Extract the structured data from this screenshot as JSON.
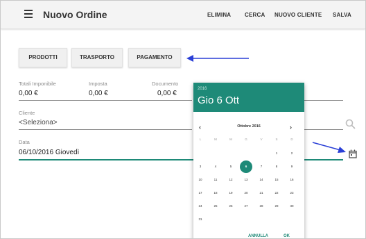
{
  "appbar": {
    "title": "Nuovo Ordine",
    "actions": [
      "ELIMINA",
      "CERCA",
      "NUOVO CLIENTE",
      "SALVA"
    ]
  },
  "tabs": [
    "PRODOTTI",
    "TRASPORTO",
    "PAGAMENTO"
  ],
  "totals": {
    "imponibile_label": "Totali Imponibile",
    "imponibile_value": "0,00 €",
    "imposta_label": "Imposta",
    "imposta_value": "0,00 €",
    "documento_label": "Documento",
    "documento_value": "0,00 €"
  },
  "cliente": {
    "label": "Cliente",
    "value": "<Seleziona>"
  },
  "data": {
    "label": "Data",
    "value": "06/10/2016  Giovedì"
  },
  "datepicker": {
    "year": "2016",
    "selected_date": "Gio 6 Ott",
    "month_label": "Ottobre 2016",
    "prev": "‹",
    "next": "›",
    "weekdays": [
      "L",
      "M",
      "M",
      "G",
      "V",
      "S",
      "D"
    ],
    "weeks": [
      [
        "",
        "",
        "",
        "",
        "",
        "1",
        "2"
      ],
      [
        "3",
        "4",
        "5",
        "6",
        "7",
        "8",
        "9"
      ],
      [
        "10",
        "11",
        "12",
        "13",
        "14",
        "15",
        "16"
      ],
      [
        "17",
        "18",
        "19",
        "20",
        "21",
        "22",
        "23"
      ],
      [
        "24",
        "25",
        "26",
        "27",
        "28",
        "29",
        "30"
      ],
      [
        "31",
        "",
        "",
        "",
        "",
        "",
        ""
      ]
    ],
    "selected_day": "6",
    "cancel_label": "ANNULLA",
    "ok_label": "OK"
  },
  "colors": {
    "accent": "#1e8a78",
    "annotation_arrow": "#2a3fd6"
  },
  "icons": [
    "menu-icon",
    "search-icon",
    "calendar-icon"
  ]
}
